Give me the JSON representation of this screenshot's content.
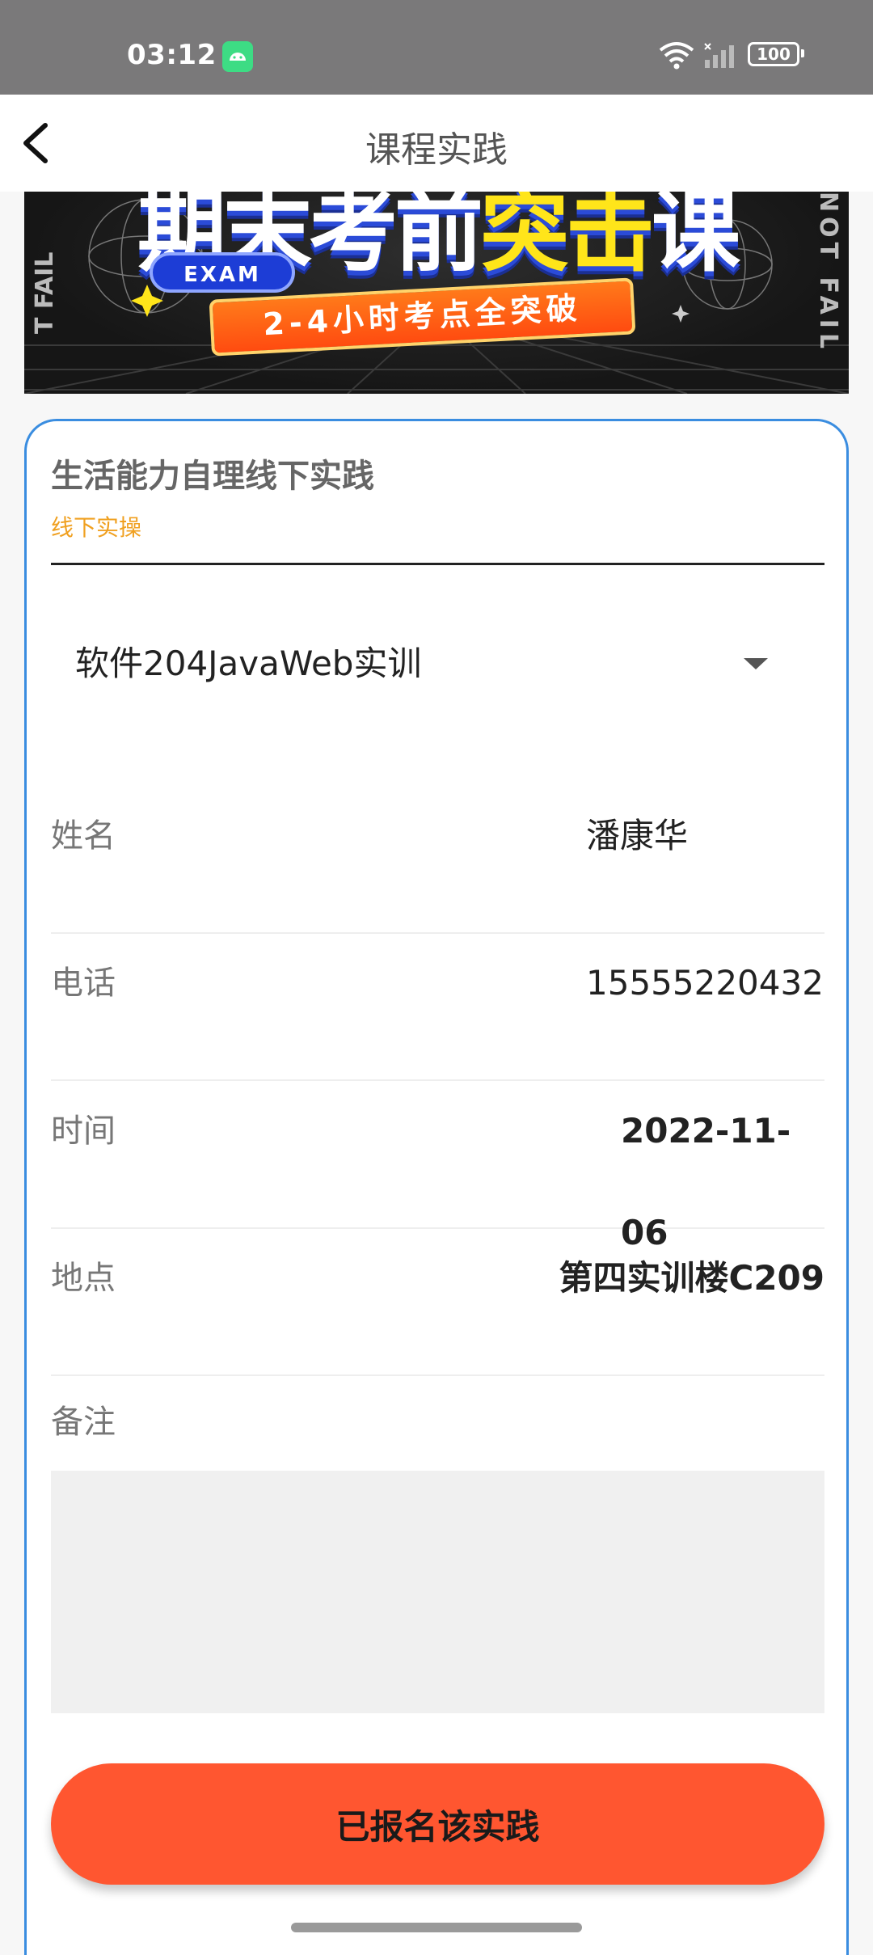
{
  "status_bar": {
    "time": "03:12",
    "battery": "100"
  },
  "header": {
    "title": "课程实践"
  },
  "banner": {
    "headline_part1": "期末考前",
    "headline_part2": "突击",
    "headline_part3": "课",
    "badge": "EXAM",
    "subline": "2-4小时考点全突破",
    "side_left": "T FAIL",
    "side_right": "NOT FAIL"
  },
  "course": {
    "title": "生活能力自理线下实践",
    "tag": "线下实操",
    "class_selected": "软件204JavaWeb实训"
  },
  "fields": {
    "name_label": "姓名",
    "name_value": "潘康华",
    "phone_label": "电话",
    "phone_value": "15555220432",
    "time_label": "时间",
    "time_value": "2022-11-06",
    "place_label": "地点",
    "place_value": "第四实训楼C209",
    "remark_label": "备注",
    "remark_value": ""
  },
  "action": {
    "enroll_label": "已报名该实践"
  },
  "colors": {
    "accent_border": "#3a8de0",
    "button": "#ff5630",
    "tag": "#f0a020"
  }
}
